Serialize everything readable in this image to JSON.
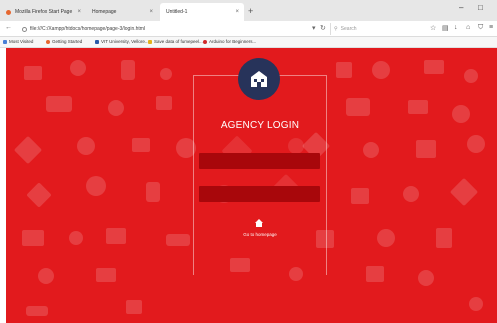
{
  "browser": {
    "tabs": [
      {
        "label": "Mozilla Firefox Start Page"
      },
      {
        "label": "Homepage"
      },
      {
        "label": "Untitled-1"
      }
    ],
    "url": "file:///C:/Xampp/htdocs/homepage/page-3/login.html",
    "search_placeholder": "Search",
    "bookmarks": [
      {
        "label": "Most Visited"
      },
      {
        "label": "Getting Started"
      },
      {
        "label": "VIT University, Vellore..."
      },
      {
        "label": "Save data of fumepeel..."
      },
      {
        "label": "Arduino for Beginners..."
      }
    ]
  },
  "login": {
    "title": "AGENCY LOGIN",
    "home_link": "Go to homepage"
  },
  "colors": {
    "background": "#e21a1d",
    "field": "#a8070b",
    "logo_circle": "#27335a"
  }
}
